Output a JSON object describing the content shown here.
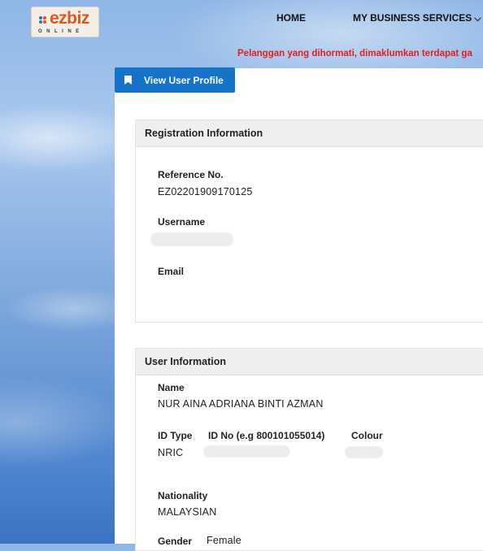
{
  "header": {
    "logo_text": "ezbiz",
    "logo_subtext": "ONLINE",
    "nav": [
      {
        "label": "HOME"
      },
      {
        "label": "MY BUSINESS SERVICES"
      }
    ],
    "announcement": "Pelanggan yang dihormati, dimaklumkan terdapat ga"
  },
  "tab": {
    "label": "View User Profile",
    "icon": "bookmark-icon"
  },
  "registration": {
    "title": "Registration Information",
    "reference_label": "Reference No.",
    "reference_value": "EZ02201909170125",
    "username_label": "Username",
    "email_label": "Email"
  },
  "user": {
    "title": "User Information",
    "name_label": "Name",
    "name_value": "NUR AINA ADRIANA BINTI AZMAN",
    "id_type_label": "ID Type",
    "id_type_value": "NRIC",
    "id_no_label": "ID No (e.g 800101055014)",
    "colour_label": "Colour",
    "nationality_label": "Nationality",
    "nationality_value": "MALAYSIAN",
    "gender_label": "Gender",
    "gender_value": "Female"
  },
  "colors": {
    "accent": "#1573c9",
    "announcement": "#e41e1e",
    "logo": "#e2561c"
  }
}
